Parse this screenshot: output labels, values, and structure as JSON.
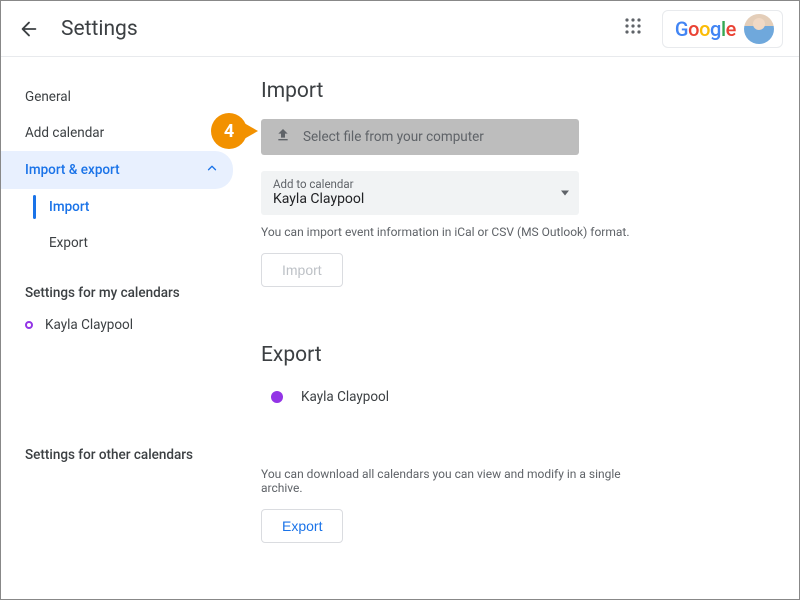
{
  "header": {
    "title": "Settings",
    "brand": "Google"
  },
  "sidebar": {
    "items": [
      {
        "label": "General"
      },
      {
        "label": "Add calendar"
      },
      {
        "label": "Import & export"
      }
    ],
    "sub_items": [
      {
        "label": "Import"
      },
      {
        "label": "Export"
      }
    ],
    "my_cal_heading": "Settings for my calendars",
    "my_calendars": [
      {
        "name": "Kayla Claypool"
      }
    ],
    "other_cal_heading": "Settings for other calendars"
  },
  "import": {
    "title": "Import",
    "file_button": "Select file from your computer",
    "add_label": "Add to calendar",
    "add_value": "Kayla Claypool",
    "hint": "You can import event information in iCal or CSV (MS Outlook) format.",
    "button": "Import"
  },
  "export": {
    "title": "Export",
    "calendar_name": "Kayla Claypool",
    "hint": "You can download all calendars you can view and modify in a single archive.",
    "button": "Export"
  },
  "callout": {
    "number": "4"
  }
}
